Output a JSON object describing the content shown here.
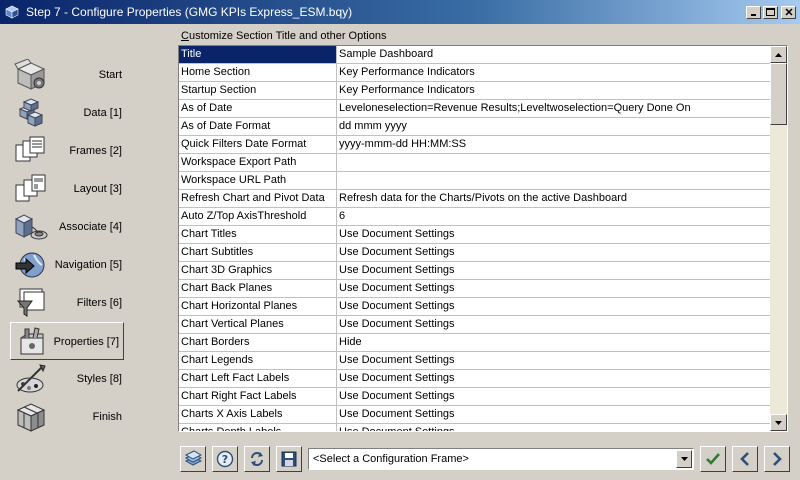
{
  "window": {
    "title": "Step 7 - Configure Properties (GMG KPIs Express_ESM.bqy)"
  },
  "sidebar": {
    "items": [
      {
        "label": "Start",
        "icon": "start-box-icon"
      },
      {
        "label": "Data [1]",
        "icon": "data-cubes-icon"
      },
      {
        "label": "Frames [2]",
        "icon": "frames-icon"
      },
      {
        "label": "Layout [3]",
        "icon": "layout-icon"
      },
      {
        "label": "Associate [4]",
        "icon": "associate-icon"
      },
      {
        "label": "Navigation [5]",
        "icon": "navigation-icon"
      },
      {
        "label": "Filters [6]",
        "icon": "filters-icon"
      },
      {
        "label": "Properties [7]",
        "icon": "properties-icon"
      },
      {
        "label": "Styles [8]",
        "icon": "styles-icon"
      },
      {
        "label": "Finish",
        "icon": "finish-cube-icon"
      }
    ],
    "active_index": 7
  },
  "main": {
    "section_label_first": "C",
    "section_label_rest": "ustomize Section Title and other Options",
    "rows": [
      {
        "name": "Title",
        "value": "Sample Dashboard"
      },
      {
        "name": "Home Section",
        "value": "Key Performance Indicators"
      },
      {
        "name": "Startup Section",
        "value": "Key Performance Indicators"
      },
      {
        "name": "As of Date",
        "value": "Leveloneselection=Revenue Results;Leveltwoselection=Query Done On"
      },
      {
        "name": "As of Date Format",
        "value": "dd mmm yyyy"
      },
      {
        "name": "Quick Filters Date Format",
        "value": "yyyy-mmm-dd HH:MM:SS"
      },
      {
        "name": "Workspace Export Path",
        "value": ""
      },
      {
        "name": "Workspace URL Path",
        "value": ""
      },
      {
        "name": "Refresh Chart and Pivot Data",
        "value": "Refresh data for the Charts/Pivots on the active Dashboard"
      },
      {
        "name": "Auto Z/Top AxisThreshold",
        "value": "6"
      },
      {
        "name": "Chart Titles",
        "value": "Use Document Settings"
      },
      {
        "name": "Chart Subtitles",
        "value": "Use Document Settings"
      },
      {
        "name": "Chart 3D Graphics",
        "value": "Use Document Settings"
      },
      {
        "name": "Chart Back Planes",
        "value": "Use Document Settings"
      },
      {
        "name": "Chart Horizontal Planes",
        "value": "Use Document Settings"
      },
      {
        "name": "Chart Vertical Planes",
        "value": "Use Document Settings"
      },
      {
        "name": "Chart Borders",
        "value": "Hide"
      },
      {
        "name": "Chart Legends",
        "value": "Use Document Settings"
      },
      {
        "name": "Chart Left Fact Labels",
        "value": "Use Document Settings"
      },
      {
        "name": "Chart Right Fact Labels",
        "value": "Use Document Settings"
      },
      {
        "name": "Charts X Axis Labels",
        "value": "Use Document Settings"
      },
      {
        "name": "Charts Depth Labels",
        "value": "Use Document Settings"
      }
    ]
  },
  "toolbar": {
    "combo_value": "<Select a Configuration Frame>"
  }
}
